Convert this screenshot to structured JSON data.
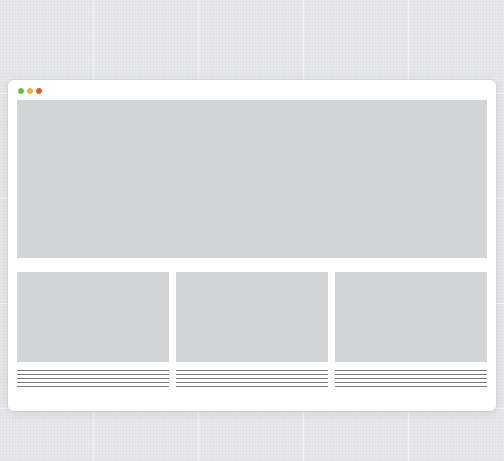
{
  "page": {
    "background_color": "#e8e9eb"
  },
  "window": {
    "title_bar_dots": [
      {
        "name": "green-dot",
        "color": "#5fbf4a"
      },
      {
        "name": "yellow-dot",
        "color": "#f2b134"
      },
      {
        "name": "orange-dot",
        "color": "#e4572e"
      }
    ],
    "placeholder_color": "#d3d4d5",
    "text_line_color": "#7a7b7d"
  },
  "cards": [
    {
      "name": "card-1",
      "text_lines": 5
    },
    {
      "name": "card-2",
      "text_lines": 5
    },
    {
      "name": "card-3",
      "text_lines": 5
    }
  ]
}
